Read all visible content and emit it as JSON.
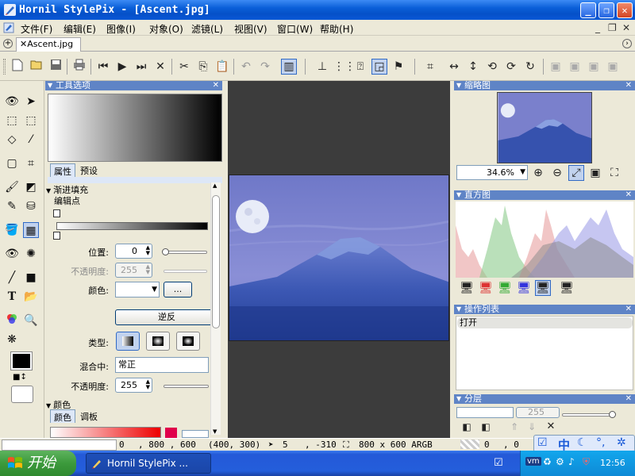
{
  "window": {
    "title": "Hornil StylePix - [Ascent.jpg]",
    "minimize": "_",
    "restore": "❐",
    "close": "✕"
  },
  "menu": {
    "items": [
      "文件(F)",
      "编辑(E)",
      "图像(I)",
      "对象(O)",
      "滤镜(L)",
      "视图(V)",
      "窗口(W)",
      "帮助(H)"
    ],
    "mdi_min": "_",
    "mdi_restore": "❐",
    "mdi_close": "✕"
  },
  "tabs": {
    "plus": "+",
    "active_label": "✕Ascent.jpg",
    "scroll": "›"
  },
  "tool_options": {
    "header": "工具选项",
    "subtab_props": "属性",
    "subtab_preset": "预设",
    "section_gradient": "渐进填充",
    "edit_points": "编辑点",
    "position_label": "位置:",
    "position_value": "0",
    "opacity_label_dim": "不透明度:",
    "opacity_value_dim": "255",
    "color_label": "颜色:",
    "dots_button": "...",
    "reverse_button": "逆反",
    "type_label": "类型:",
    "blend_label": "混合中:",
    "blend_value": "常正",
    "opacity_label": "不透明度:",
    "opacity_value": "255",
    "color_section": "颜色",
    "color_tab": "颜色",
    "palette_tab": "调板"
  },
  "thumbnail": {
    "header": "缩略图",
    "zoom": "34.6%"
  },
  "histogram": {
    "header": "直方图"
  },
  "history": {
    "header": "操作列表",
    "items": [
      "打开"
    ]
  },
  "layers": {
    "header": "分层",
    "opacity": "255"
  },
  "status": {
    "coord1": "0",
    "coord2": ", 800 , 600",
    "coord3": "(400, 300)",
    "cursor_x": "5",
    "cursor_y": ", -310",
    "dims": "800 x 600 ARGB",
    "sel_x": "0",
    "sel_y": ", 0"
  },
  "taskbar": {
    "start": "开始",
    "task": "Hornil StylePix ...",
    "clock": "12:56",
    "ime": "中"
  },
  "colors": {
    "title_blue": "#0a5fd8",
    "panel_header": "#5f84c6",
    "canvas_bg": "#3c3c3c",
    "sky": "#7e86d4",
    "mountain": "#2f4fa8"
  }
}
